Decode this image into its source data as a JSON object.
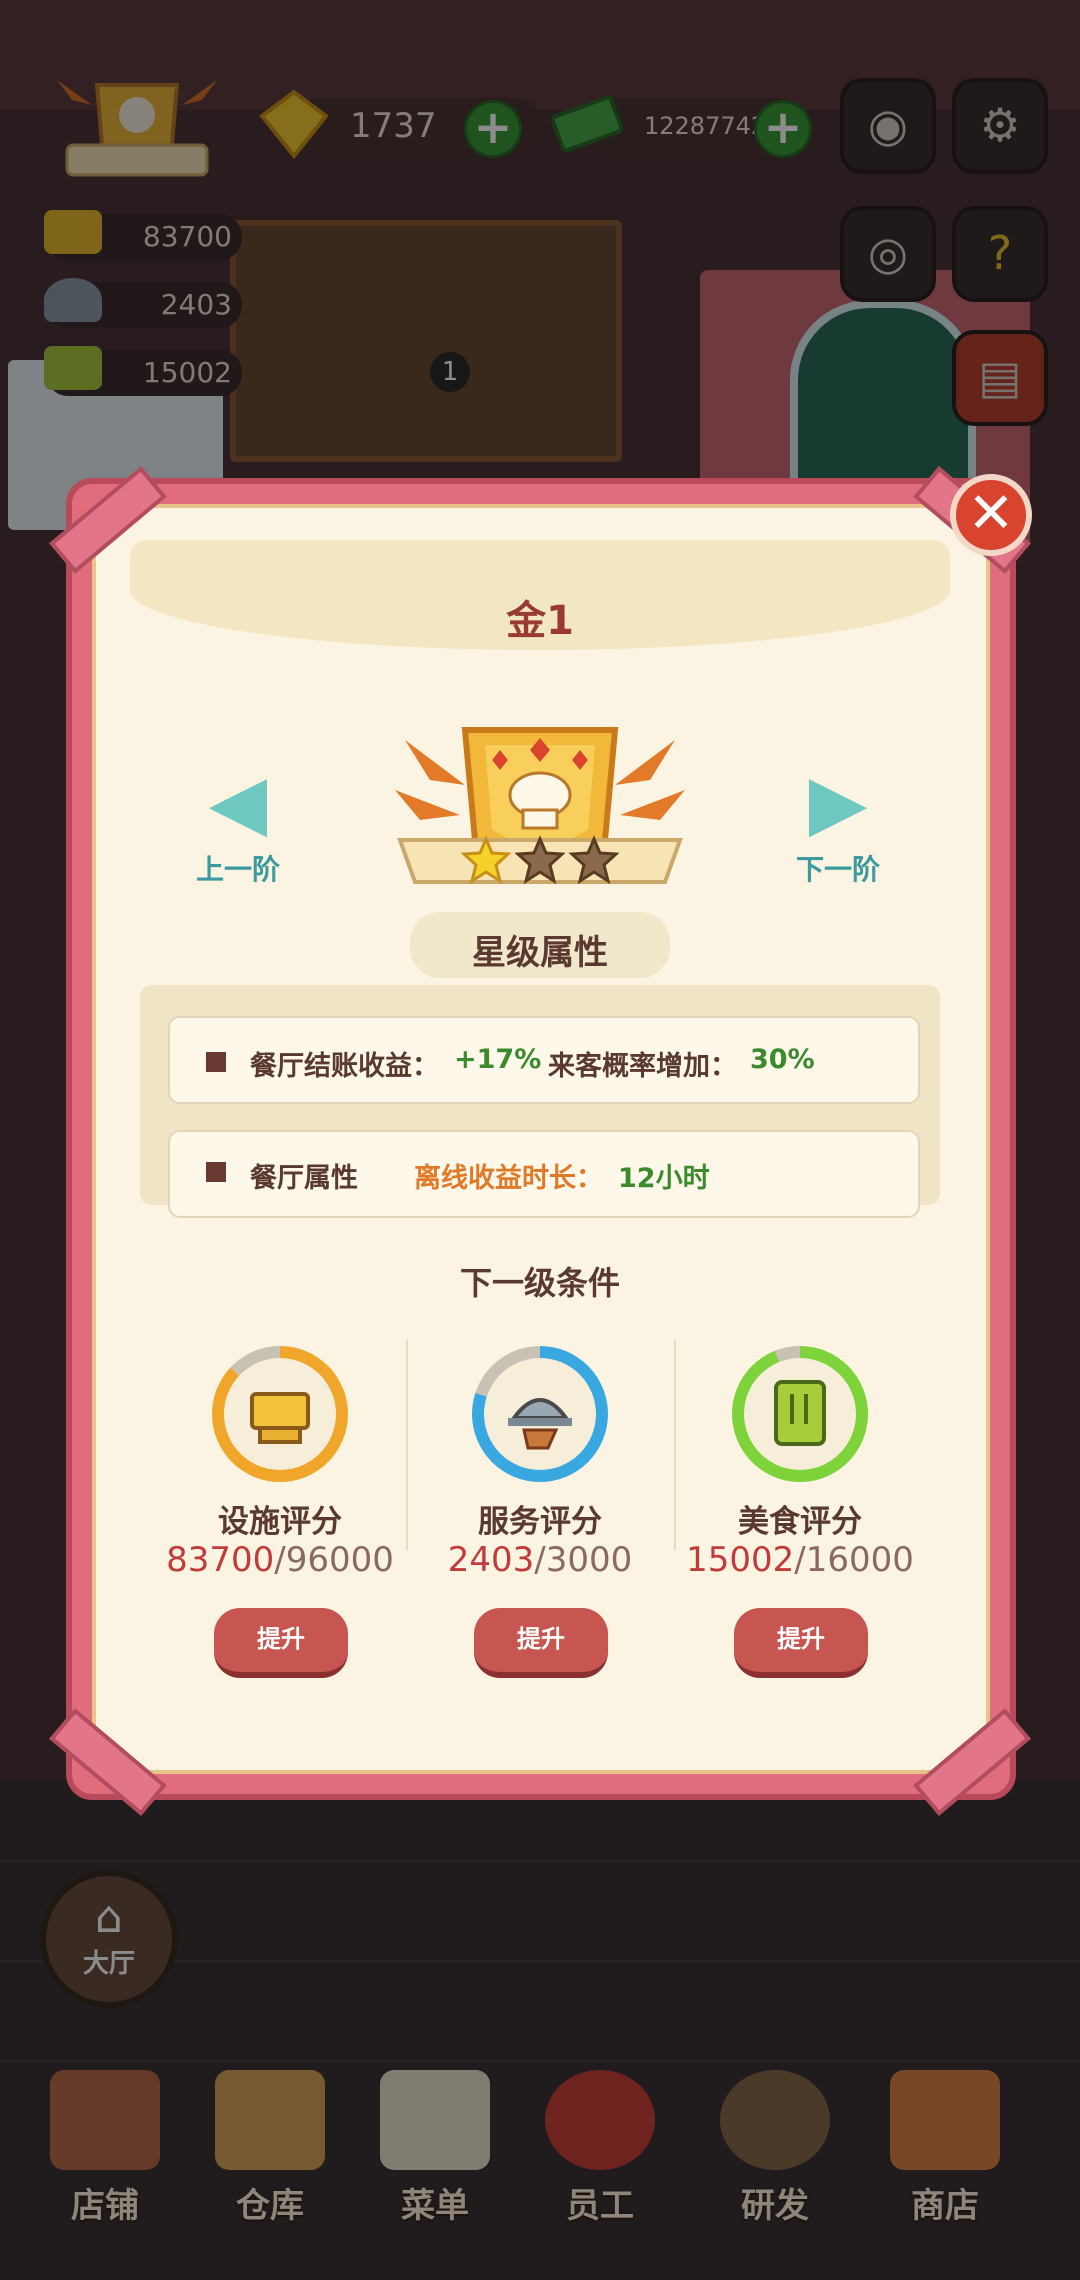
{
  "top_bar": {
    "gems": "1737",
    "cash": "12287742"
  },
  "side_stats": {
    "facility": "83700",
    "service": "2403",
    "food": "15002"
  },
  "scene": {
    "plate_count": "1"
  },
  "hall_button": {
    "label": "大厅"
  },
  "bottom_nav": [
    {
      "label": "店铺"
    },
    {
      "label": "仓库"
    },
    {
      "label": "菜单"
    },
    {
      "label": "员工"
    },
    {
      "label": "研发"
    },
    {
      "label": "商店"
    }
  ],
  "modal": {
    "title": "金1",
    "prev_label": "上一阶",
    "next_label": "下一阶",
    "stars_filled": 1,
    "stars_total": 3,
    "section_title": "星级属性",
    "attr1": {
      "label1": "餐厅结账收益：",
      "value1": "+17%",
      "label2": "来客概率增加：",
      "value2": "30%"
    },
    "attr2": {
      "label1": "餐厅属性",
      "label2": "离线收益时长：",
      "value2": "12小时"
    },
    "next_level_title": "下一级条件",
    "requirements": [
      {
        "label": "设施评分",
        "current": "83700",
        "total": "/96000",
        "progress": 0.87,
        "ring_color": "#f0a62a",
        "button": "提升"
      },
      {
        "label": "服务评分",
        "current": "2403",
        "total": "/3000",
        "progress": 0.8,
        "ring_color": "#3aa8e0",
        "button": "提升"
      },
      {
        "label": "美食评分",
        "current": "15002",
        "total": "/16000",
        "progress": 0.94,
        "ring_color": "#7ed23a",
        "button": "提升"
      }
    ]
  }
}
